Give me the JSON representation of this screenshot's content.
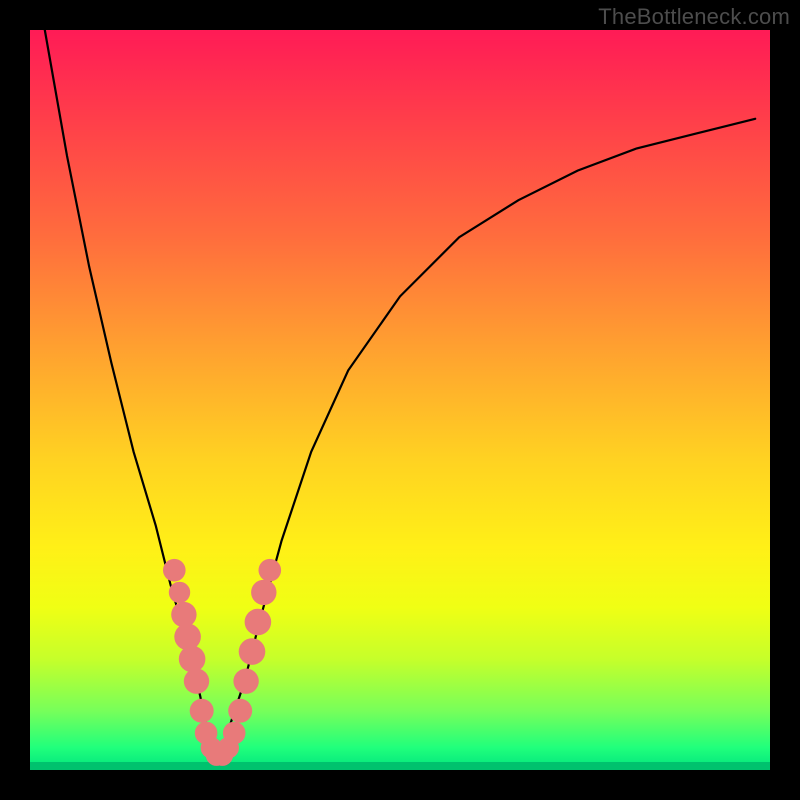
{
  "watermark": "TheBottleneck.com",
  "colors": {
    "background_black": "#000000",
    "gradient_top": "#ff1b56",
    "gradient_bottom": "#00e47e",
    "marker": "#e87a7a",
    "curve": "#000000",
    "watermark_text": "#4d4d4d"
  },
  "chart_data": {
    "type": "line",
    "title": "",
    "xlabel": "",
    "ylabel": "",
    "xlim": [
      0,
      100
    ],
    "ylim": [
      0,
      100
    ],
    "grid": false,
    "legend": false,
    "series": [
      {
        "name": "bottleneck-curve",
        "comment": "V-shaped curve; minimum near x≈25. y=100 at top (red), y=0 at bottom (green). Values estimated from gridless plot.",
        "x": [
          2,
          5,
          8,
          11,
          14,
          17,
          19,
          21,
          23,
          24,
          25,
          26,
          27,
          29,
          31,
          34,
          38,
          43,
          50,
          58,
          66,
          74,
          82,
          90,
          98
        ],
        "y": [
          100,
          83,
          68,
          55,
          43,
          33,
          25,
          18,
          10,
          5,
          2,
          3,
          6,
          12,
          20,
          31,
          43,
          54,
          64,
          72,
          77,
          81,
          84,
          86,
          88
        ]
      }
    ],
    "markers": {
      "comment": "Salmon dot clusters along the lower V; positions approximate in chart coords.",
      "points": [
        {
          "x": 19.5,
          "y": 27,
          "r": 1.1
        },
        {
          "x": 20.2,
          "y": 24,
          "r": 1.0
        },
        {
          "x": 20.8,
          "y": 21,
          "r": 1.3
        },
        {
          "x": 21.3,
          "y": 18,
          "r": 1.4
        },
        {
          "x": 21.9,
          "y": 15,
          "r": 1.4
        },
        {
          "x": 22.5,
          "y": 12,
          "r": 1.3
        },
        {
          "x": 23.2,
          "y": 8,
          "r": 1.2
        },
        {
          "x": 23.8,
          "y": 5,
          "r": 1.1
        },
        {
          "x": 24.5,
          "y": 3,
          "r": 1.0
        },
        {
          "x": 25.2,
          "y": 2,
          "r": 1.0
        },
        {
          "x": 26.0,
          "y": 2,
          "r": 1.0
        },
        {
          "x": 26.8,
          "y": 3,
          "r": 1.0
        },
        {
          "x": 27.6,
          "y": 5,
          "r": 1.1
        },
        {
          "x": 28.4,
          "y": 8,
          "r": 1.2
        },
        {
          "x": 29.2,
          "y": 12,
          "r": 1.3
        },
        {
          "x": 30.0,
          "y": 16,
          "r": 1.4
        },
        {
          "x": 30.8,
          "y": 20,
          "r": 1.4
        },
        {
          "x": 31.6,
          "y": 24,
          "r": 1.3
        },
        {
          "x": 32.4,
          "y": 27,
          "r": 1.1
        }
      ]
    }
  }
}
